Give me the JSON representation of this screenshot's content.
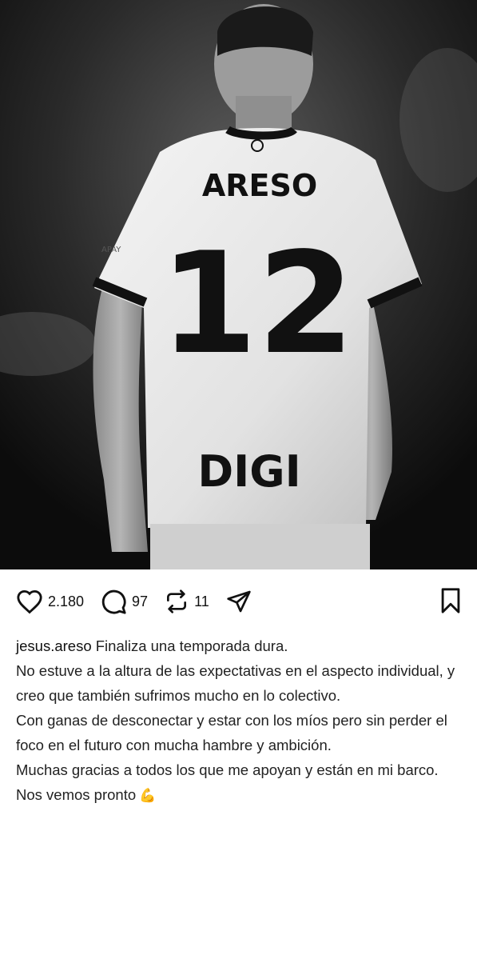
{
  "photo": {
    "jersey_name": "ARESO",
    "jersey_number": "12",
    "sponsor": "DIGI",
    "sleeve_text": "APAY"
  },
  "actions": {
    "likes": "2.180",
    "comments": "97",
    "reposts": "11"
  },
  "caption": {
    "username": "jesus.areso",
    "first_line": "Finaliza una temporada dura.",
    "lines": [
      "No estuve a la altura de las expectativas en el aspecto individual, y creo que también sufrimos mucho en lo colectivo.",
      "Con ganas de desconectar y estar con los míos pero sin perder el foco en el futuro con mucha hambre y ambición.",
      "Muchas gracias a todos los que me apoyan y están en mi barco."
    ],
    "last_line": "Nos vemos pronto",
    "emoji": "💪"
  },
  "colors": {
    "background": "#ffffff",
    "text": "#222222",
    "icon": "#111111"
  }
}
